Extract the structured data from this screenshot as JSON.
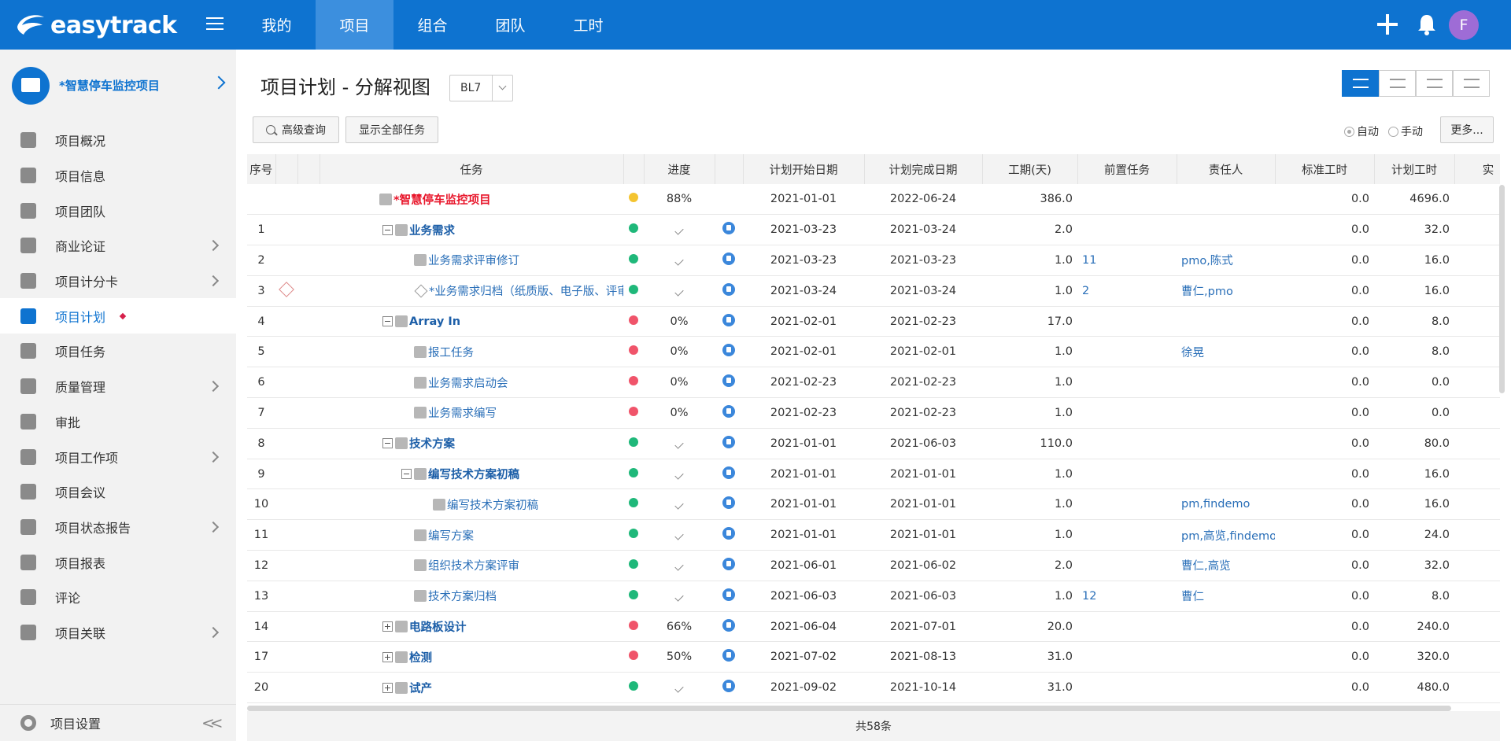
{
  "app": {
    "logo_text": "easytrack"
  },
  "nav": {
    "items": [
      {
        "label": "我的",
        "active": false
      },
      {
        "label": "项目",
        "active": true
      },
      {
        "label": "组合",
        "active": false
      },
      {
        "label": "团队",
        "active": false
      },
      {
        "label": "工时",
        "active": false
      }
    ]
  },
  "user": {
    "avatar_letter": "F"
  },
  "sidebar": {
    "project_name": "*智慧停车监控项目",
    "items": [
      {
        "label": "项目概况",
        "icon": "pie-chart-icon",
        "chevron": false
      },
      {
        "label": "项目信息",
        "icon": "info-icon",
        "chevron": false
      },
      {
        "label": "项目团队",
        "icon": "team-icon",
        "chevron": false
      },
      {
        "label": "商业论证",
        "icon": "flag-icon",
        "chevron": true
      },
      {
        "label": "项目计分卡",
        "icon": "target-icon",
        "chevron": true
      },
      {
        "label": "项目计划",
        "icon": "plan-icon",
        "chevron": false,
        "active": true
      },
      {
        "label": "项目任务",
        "icon": "calendar-icon",
        "chevron": false
      },
      {
        "label": "质量管理",
        "icon": "shield-icon",
        "chevron": true
      },
      {
        "label": "审批",
        "icon": "stamp-icon",
        "chevron": false
      },
      {
        "label": "项目工作项",
        "icon": "list-icon",
        "chevron": true
      },
      {
        "label": "项目会议",
        "icon": "meeting-icon",
        "chevron": false
      },
      {
        "label": "项目状态报告",
        "icon": "report-icon",
        "chevron": true
      },
      {
        "label": "项目报表",
        "icon": "chart-icon",
        "chevron": false
      },
      {
        "label": "评论",
        "icon": "comment-icon",
        "chevron": false
      },
      {
        "label": "项目关联",
        "icon": "link-icon",
        "chevron": true
      }
    ],
    "footer_label": "项目设置"
  },
  "page": {
    "title": "项目计划 - 分解视图",
    "version": "BL7",
    "btn_search": "高级查询",
    "btn_showall": "显示全部任务",
    "radio_auto": "自动",
    "radio_manual": "手动",
    "btn_more": "更多...",
    "footer_count": "共58条"
  },
  "colors": {
    "accent": "#0e73d0",
    "green": "#1fb87a",
    "red": "#f0546a",
    "yellow": "#f4c430"
  },
  "table": {
    "headers": [
      "序号",
      "",
      "",
      "任务",
      "",
      "进度",
      "",
      "计划开始日期",
      "计划完成日期",
      "工期(天)",
      "前置任务",
      "责任人",
      "标准工时",
      "计划工时",
      "实"
    ],
    "rows": [
      {
        "no": "",
        "warn": false,
        "level": 0,
        "exp": "",
        "kind": "root",
        "task": "*智慧停车监控项目",
        "status": "yellow",
        "progress": "88%",
        "check": false,
        "type": false,
        "start": "2021-01-01",
        "end": "2022-06-24",
        "dur": "386.0",
        "pre": "",
        "owner": "",
        "std": "0.0",
        "plan": "4696.0"
      },
      {
        "no": "1",
        "warn": false,
        "level": 0,
        "exp": "minus",
        "kind": "bold",
        "task": "业务需求",
        "status": "green",
        "progress": "",
        "check": true,
        "type": true,
        "start": "2021-03-23",
        "end": "2021-03-24",
        "dur": "2.0",
        "pre": "",
        "owner": "",
        "std": "0.0",
        "plan": "32.0"
      },
      {
        "no": "2",
        "warn": false,
        "level": 1,
        "exp": "",
        "kind": "task",
        "task": "业务需求评审修订",
        "status": "green",
        "progress": "",
        "check": true,
        "type": true,
        "start": "2021-03-23",
        "end": "2021-03-23",
        "dur": "1.0",
        "pre": "11",
        "owner": "pmo,陈式",
        "std": "0.0",
        "plan": "16.0"
      },
      {
        "no": "3",
        "warn": true,
        "level": 1,
        "exp": "",
        "kind": "milestone",
        "task": "*业务需求归档（纸质版、电子版、评审会议",
        "status": "green",
        "progress": "",
        "check": true,
        "type": true,
        "start": "2021-03-24",
        "end": "2021-03-24",
        "dur": "1.0",
        "pre": "2",
        "owner": "曹仁,pmo",
        "std": "0.0",
        "plan": "16.0"
      },
      {
        "no": "4",
        "warn": false,
        "level": 0,
        "exp": "minus",
        "kind": "bold",
        "task": "Array In",
        "status": "red",
        "progress": "0%",
        "check": false,
        "type": true,
        "start": "2021-02-01",
        "end": "2021-02-23",
        "dur": "17.0",
        "pre": "",
        "owner": "",
        "std": "0.0",
        "plan": "8.0"
      },
      {
        "no": "5",
        "warn": false,
        "level": 1,
        "exp": "",
        "kind": "task",
        "task": "报工任务",
        "status": "red",
        "progress": "0%",
        "check": false,
        "type": true,
        "start": "2021-02-01",
        "end": "2021-02-01",
        "dur": "1.0",
        "pre": "",
        "owner": "徐晃",
        "std": "0.0",
        "plan": "8.0"
      },
      {
        "no": "6",
        "warn": false,
        "level": 1,
        "exp": "",
        "kind": "task",
        "task": "业务需求启动会",
        "status": "red",
        "progress": "0%",
        "check": false,
        "type": true,
        "start": "2021-02-23",
        "end": "2021-02-23",
        "dur": "1.0",
        "pre": "",
        "owner": "",
        "std": "0.0",
        "plan": "0.0"
      },
      {
        "no": "7",
        "warn": false,
        "level": 1,
        "exp": "",
        "kind": "task",
        "task": "业务需求编写",
        "status": "red",
        "progress": "0%",
        "check": false,
        "type": true,
        "start": "2021-02-23",
        "end": "2021-02-23",
        "dur": "1.0",
        "pre": "",
        "owner": "",
        "std": "0.0",
        "plan": "0.0"
      },
      {
        "no": "8",
        "warn": false,
        "level": 0,
        "exp": "minus",
        "kind": "bold",
        "task": "技术方案",
        "status": "green",
        "progress": "",
        "check": true,
        "type": true,
        "start": "2021-01-01",
        "end": "2021-06-03",
        "dur": "110.0",
        "pre": "",
        "owner": "",
        "std": "0.0",
        "plan": "80.0"
      },
      {
        "no": "9",
        "warn": false,
        "level": 1,
        "exp": "minus",
        "kind": "bold",
        "task": "编写技术方案初稿",
        "status": "green",
        "progress": "",
        "check": true,
        "type": true,
        "start": "2021-01-01",
        "end": "2021-01-01",
        "dur": "1.0",
        "pre": "",
        "owner": "",
        "std": "0.0",
        "plan": "16.0"
      },
      {
        "no": "10",
        "warn": false,
        "level": 2,
        "exp": "",
        "kind": "task",
        "task": "编写技术方案初稿",
        "status": "green",
        "progress": "",
        "check": true,
        "type": true,
        "start": "2021-01-01",
        "end": "2021-01-01",
        "dur": "1.0",
        "pre": "",
        "owner": "pm,findemo",
        "std": "0.0",
        "plan": "16.0"
      },
      {
        "no": "11",
        "warn": false,
        "level": 1,
        "exp": "",
        "kind": "task",
        "task": "编写方案",
        "status": "green",
        "progress": "",
        "check": true,
        "type": true,
        "start": "2021-01-01",
        "end": "2021-01-01",
        "dur": "1.0",
        "pre": "",
        "owner": "pm,高览,findemo",
        "std": "0.0",
        "plan": "24.0"
      },
      {
        "no": "12",
        "warn": false,
        "level": 1,
        "exp": "",
        "kind": "task",
        "task": "组织技术方案评审",
        "status": "green",
        "progress": "",
        "check": true,
        "type": true,
        "start": "2021-06-01",
        "end": "2021-06-02",
        "dur": "2.0",
        "pre": "",
        "owner": "曹仁,高览",
        "std": "0.0",
        "plan": "32.0"
      },
      {
        "no": "13",
        "warn": false,
        "level": 1,
        "exp": "",
        "kind": "task",
        "task": "技术方案归档",
        "status": "green",
        "progress": "",
        "check": true,
        "type": true,
        "start": "2021-06-03",
        "end": "2021-06-03",
        "dur": "1.0",
        "pre": "12",
        "owner": "曹仁",
        "std": "0.0",
        "plan": "8.0"
      },
      {
        "no": "14",
        "warn": false,
        "level": 0,
        "exp": "plus",
        "kind": "bold",
        "task": "电路板设计",
        "status": "red",
        "progress": "66%",
        "check": false,
        "type": true,
        "start": "2021-06-04",
        "end": "2021-07-01",
        "dur": "20.0",
        "pre": "",
        "owner": "",
        "std": "0.0",
        "plan": "240.0"
      },
      {
        "no": "17",
        "warn": false,
        "level": 0,
        "exp": "plus",
        "kind": "bold",
        "task": "检测",
        "status": "red",
        "progress": "50%",
        "check": false,
        "type": true,
        "start": "2021-07-02",
        "end": "2021-08-13",
        "dur": "31.0",
        "pre": "",
        "owner": "",
        "std": "0.0",
        "plan": "320.0"
      },
      {
        "no": "20",
        "warn": false,
        "level": 0,
        "exp": "plus",
        "kind": "bold",
        "task": "试产",
        "status": "green",
        "progress": "",
        "check": true,
        "type": true,
        "start": "2021-09-02",
        "end": "2021-10-14",
        "dur": "31.0",
        "pre": "",
        "owner": "",
        "std": "0.0",
        "plan": "480.0"
      }
    ]
  }
}
